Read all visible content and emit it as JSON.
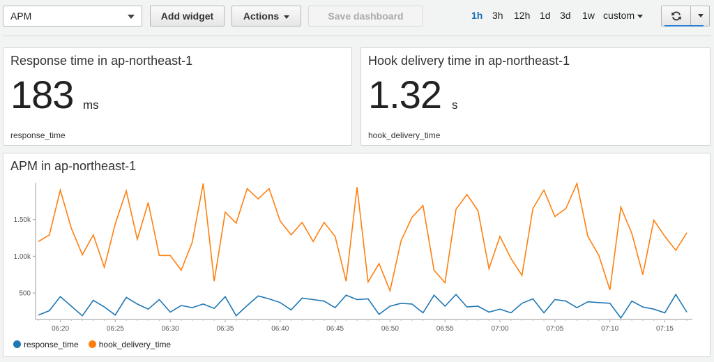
{
  "toolbar": {
    "dashboard_name": "APM",
    "add_widget": "Add widget",
    "actions": "Actions",
    "save_dashboard": "Save dashboard",
    "time_ranges": [
      "1h",
      "3h",
      "12h",
      "1d",
      "3d",
      "1w"
    ],
    "active_range": "1h",
    "custom_label": "custom",
    "refresh_icon": "refresh-icon",
    "accent_color": "#1a6fb5"
  },
  "widgets": {
    "response_time": {
      "title": "Response time in ap-northeast-1",
      "value": "183",
      "unit": "ms",
      "metric": "response_time"
    },
    "hook_delivery": {
      "title": "Hook delivery time in ap-northeast-1",
      "value": "1.32",
      "unit": "s",
      "metric": "hook_delivery_time"
    },
    "apm_chart": {
      "title": "APM in ap-northeast-1"
    }
  },
  "chart_data": {
    "type": "line",
    "title": "APM in ap-northeast-1",
    "xlabel": "",
    "ylabel": "",
    "x_start": "06:18",
    "x_tick_labels": [
      "06:20",
      "06:25",
      "06:30",
      "06:35",
      "06:40",
      "06:45",
      "06:50",
      "06:55",
      "07:00",
      "07:05",
      "07:10",
      "07:15"
    ],
    "y_tick_labels": [
      "500",
      "1.00k",
      "1.50k"
    ],
    "ylim": [
      140,
      2000
    ],
    "grid": false,
    "legend_position": "bottom-left",
    "series": [
      {
        "name": "response_time",
        "color": "#1f77b4",
        "values": [
          200,
          260,
          450,
          320,
          190,
          400,
          310,
          200,
          440,
          350,
          280,
          410,
          240,
          330,
          300,
          350,
          290,
          450,
          190,
          330,
          460,
          420,
          370,
          270,
          430,
          410,
          390,
          300,
          470,
          410,
          420,
          210,
          320,
          360,
          350,
          230,
          470,
          320,
          480,
          310,
          320,
          240,
          280,
          230,
          360,
          420,
          230,
          410,
          390,
          300,
          380,
          370,
          360,
          160,
          390,
          310,
          280,
          230,
          480,
          240
        ]
      },
      {
        "name": "hook_delivery_time",
        "color": "#ff7f0e",
        "values": [
          1200,
          1290,
          1900,
          1380,
          1020,
          1290,
          850,
          1440,
          1890,
          1230,
          1730,
          1010,
          1010,
          810,
          1190,
          1990,
          660,
          1600,
          1450,
          1920,
          1780,
          1920,
          1480,
          1290,
          1460,
          1200,
          1460,
          1270,
          660,
          1940,
          650,
          900,
          530,
          1210,
          1530,
          1690,
          810,
          640,
          1640,
          1840,
          1620,
          830,
          1270,
          970,
          740,
          1650,
          1900,
          1540,
          1650,
          1990,
          1270,
          1010,
          540,
          1670,
          1310,
          750,
          1490,
          1270,
          1080,
          1320
        ]
      }
    ]
  }
}
